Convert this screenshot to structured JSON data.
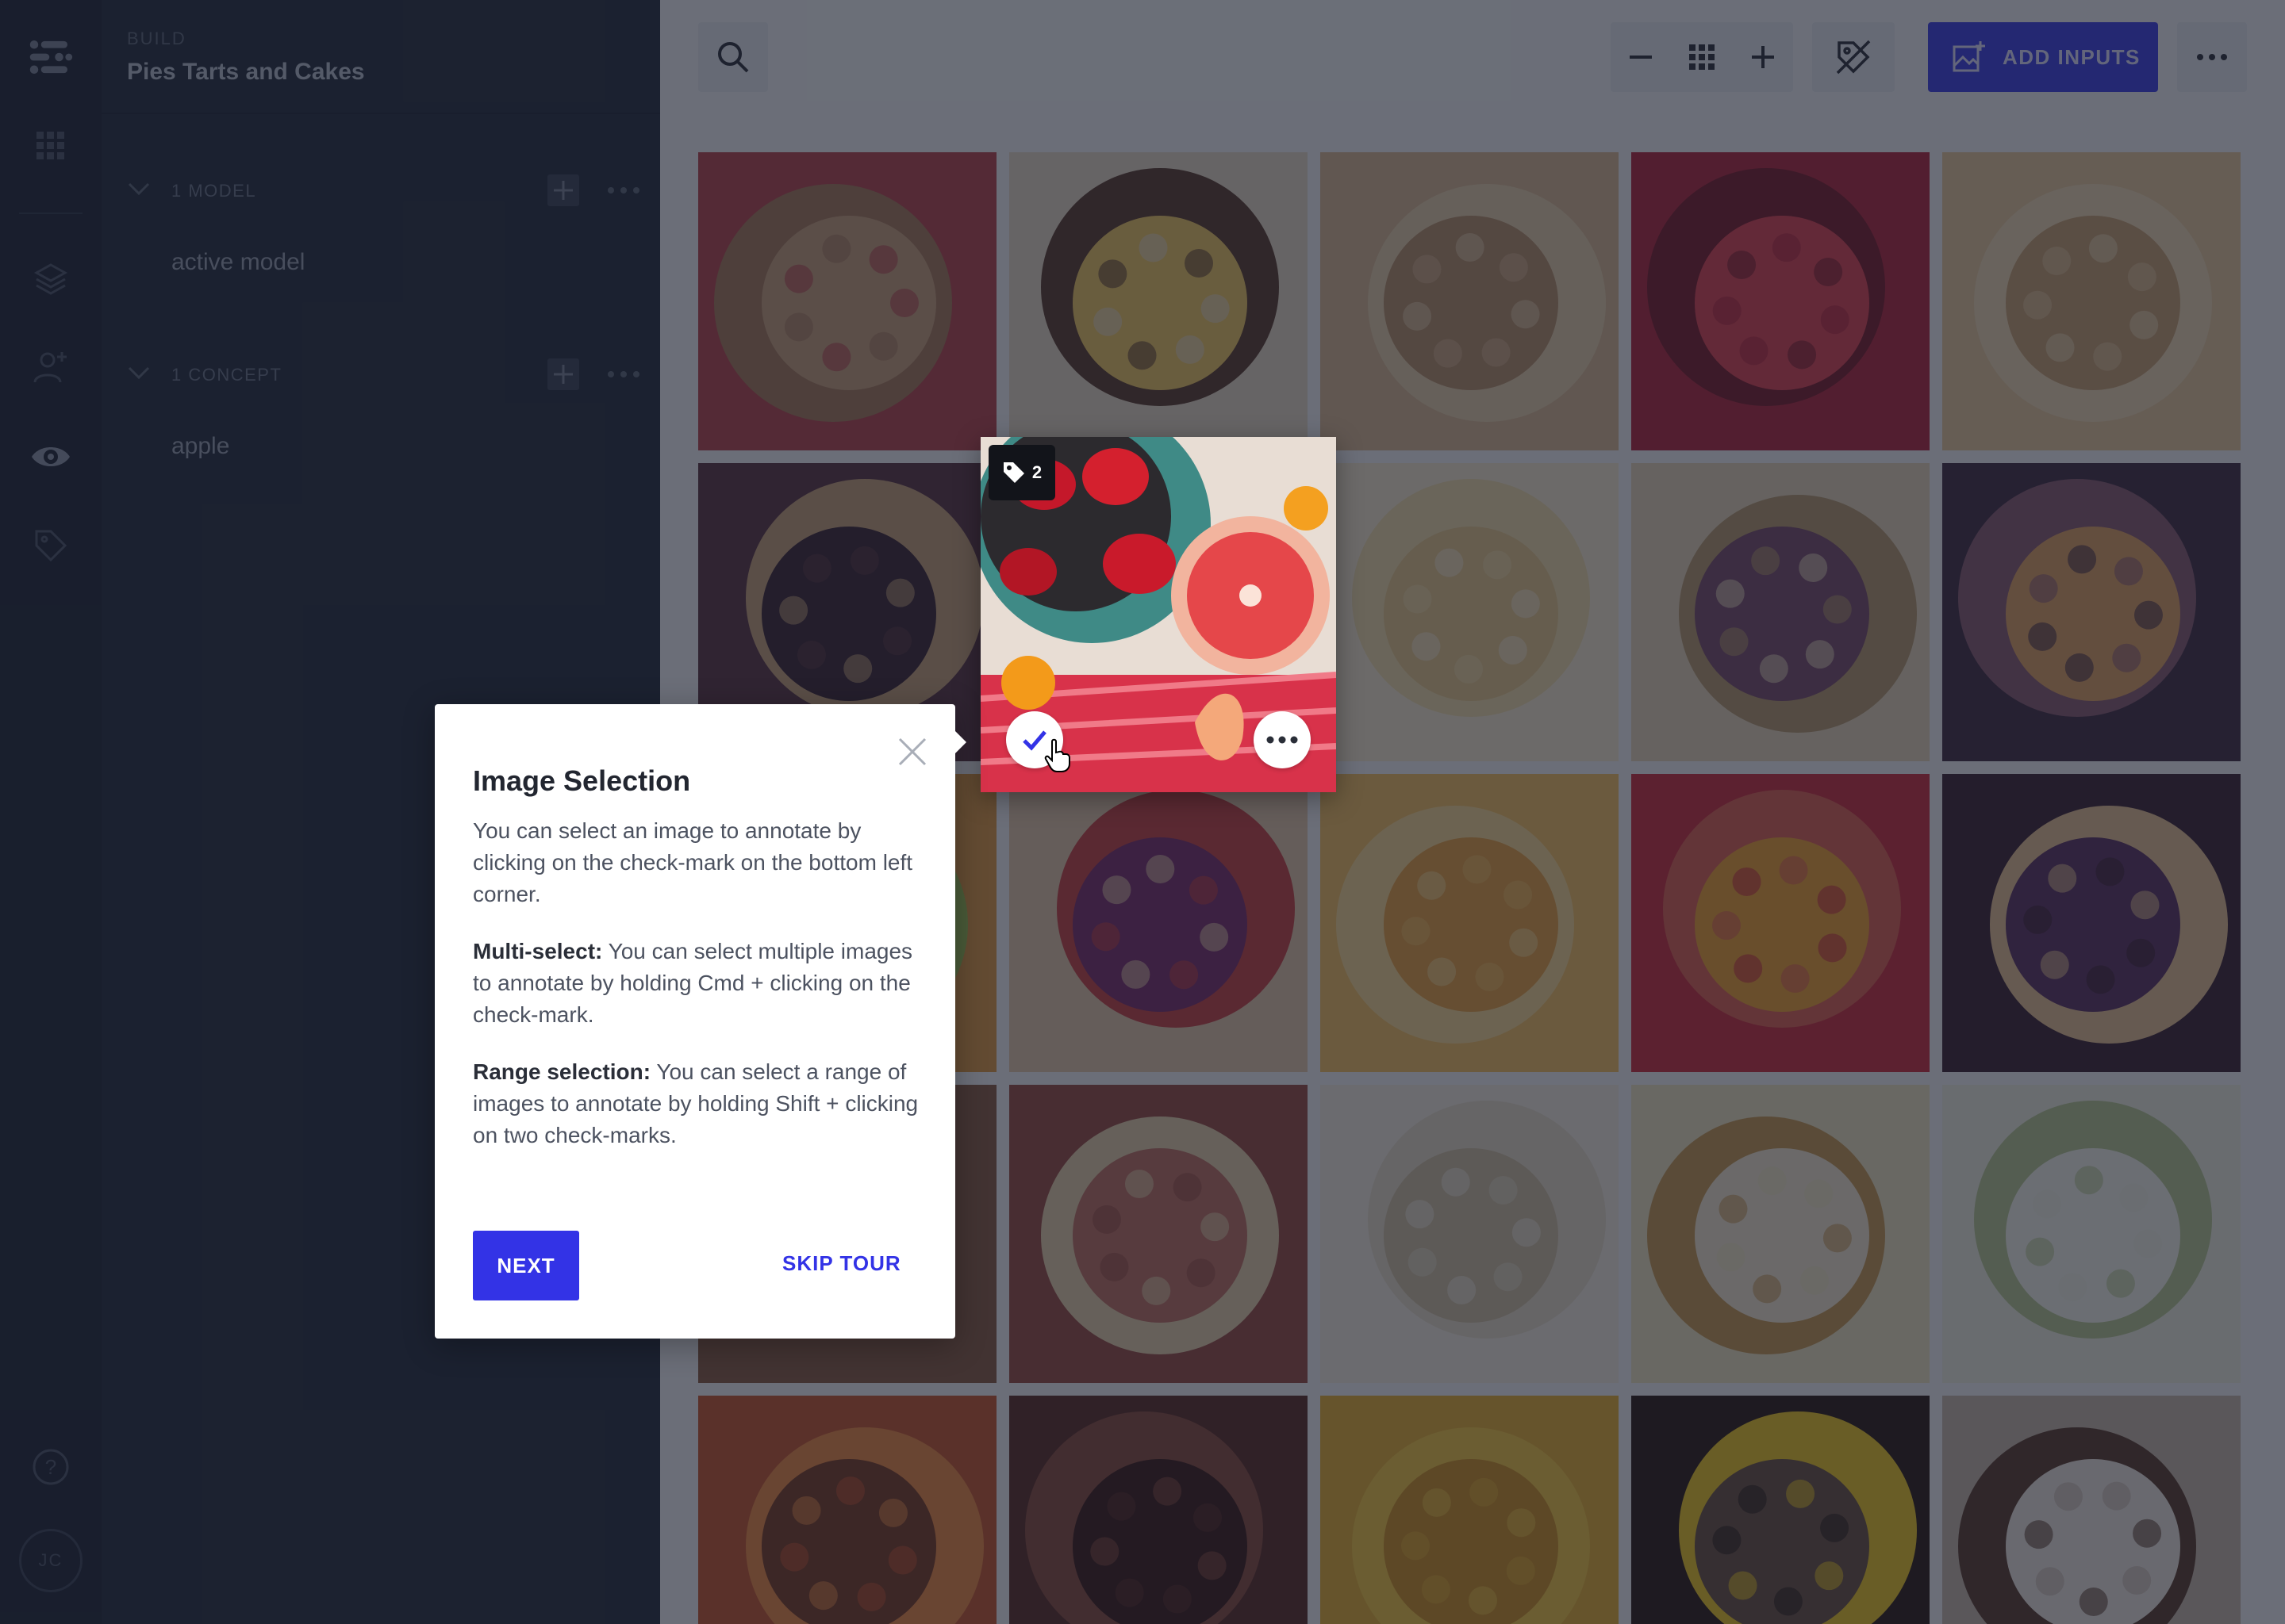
{
  "sidebar": {
    "kicker": "BUILD",
    "title": "Pies Tarts and Cakes",
    "sections": [
      {
        "label": "1 MODEL",
        "items": [
          "active model"
        ]
      },
      {
        "label": "1 CONCEPT",
        "items": [
          "apple"
        ]
      }
    ]
  },
  "rail": {
    "icons": [
      "clarifai-logo-icon",
      "apps-grid-icon",
      "layers-icon",
      "add-user-icon",
      "eye-icon",
      "tag-icon",
      "help-icon"
    ],
    "avatar_initials": "JC",
    "help_label": "?"
  },
  "toolbar": {
    "add_inputs_label": "ADD INPUTS"
  },
  "highlight_tile": {
    "tag_count": "2"
  },
  "tour": {
    "title": "Image Selection",
    "p1": "You can select an image to annotate by clicking on the check-mark on the bottom left corner.",
    "p2_bold": "Multi-select:",
    "p2": " You can select multiple images to annotate by holding Cmd + clicking on the check-mark.",
    "p3_bold": "Range selection:",
    "p3": " You can select a range of images to annotate by holding Shift + clicking on two check-marks.",
    "next_label": "NEXT",
    "skip_label": "SKIP TOUR"
  },
  "colors": {
    "accent": "#3c3de8",
    "sidebar_bg": "#232b3b",
    "rail_bg": "#1d2433"
  }
}
